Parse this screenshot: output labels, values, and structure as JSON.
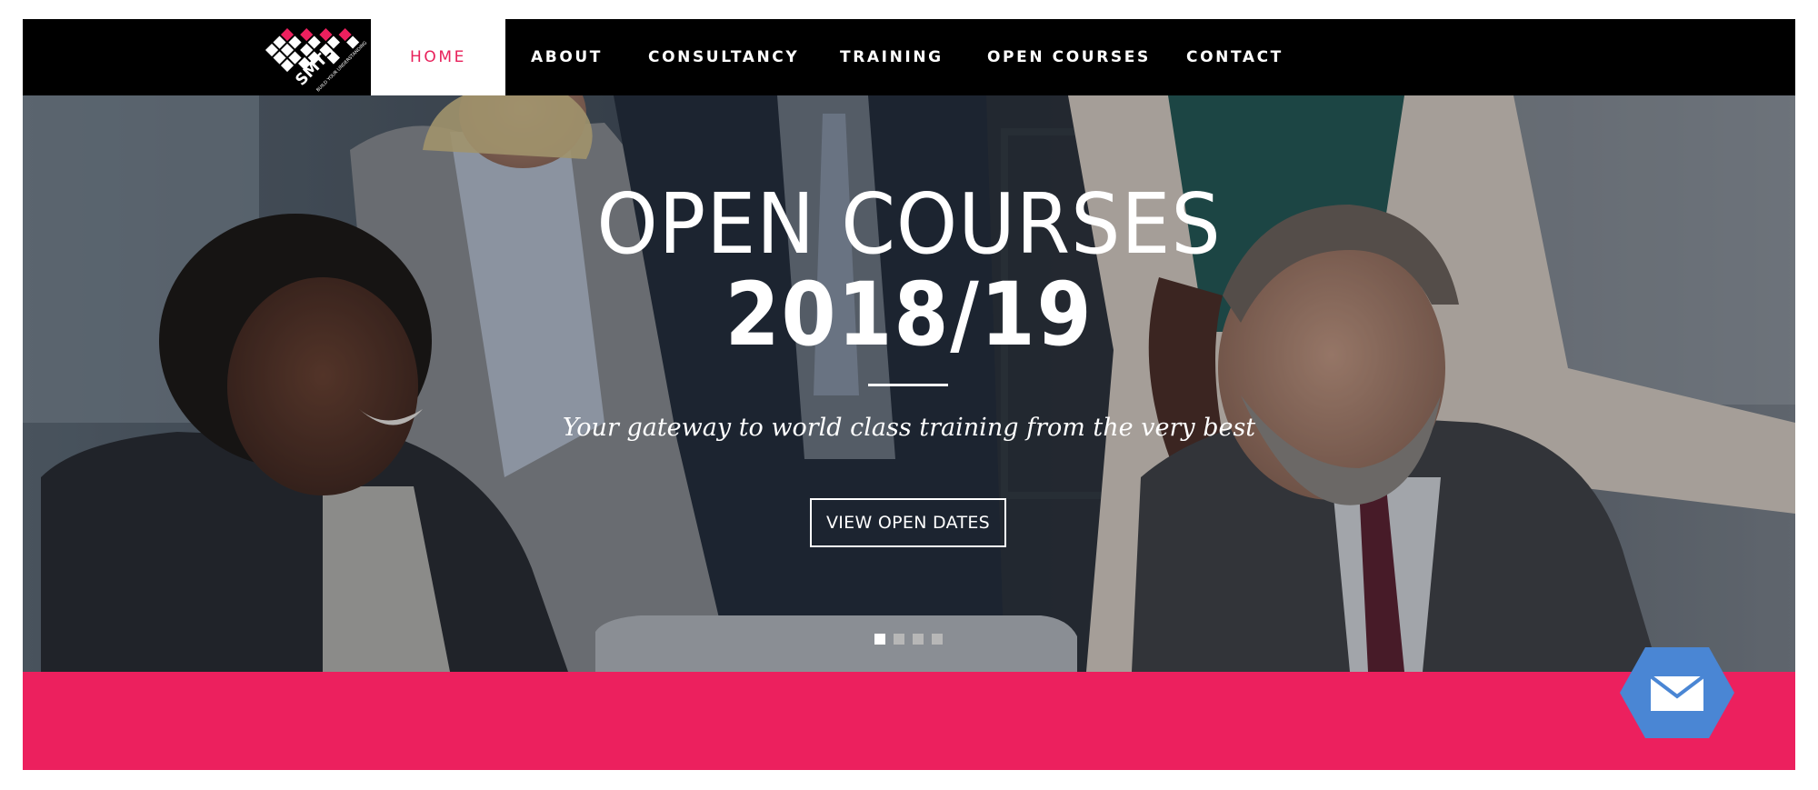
{
  "brand": {
    "logo_text": "SMTS",
    "logo_tagline": "BUILD YOUR UNDERSTANDING",
    "colors": {
      "accent": "#ec205e",
      "nav_bg": "#000000",
      "mail_button": "#4a86d4"
    }
  },
  "nav": {
    "items": [
      {
        "label": "HOME",
        "active": true
      },
      {
        "label": "ABOUT",
        "active": false
      },
      {
        "label": "CONSULTANCY",
        "active": false
      },
      {
        "label": "TRAINING",
        "active": false
      },
      {
        "label": "OPEN COURSES",
        "active": false
      },
      {
        "label": "CONTACT",
        "active": false
      }
    ]
  },
  "hero": {
    "title": "OPEN COURSES",
    "year": "2018/19",
    "tagline": "Your gateway to world class training from the very best",
    "button_label": "VIEW OPEN DATES",
    "slides_total": 4,
    "active_slide": 1
  },
  "floating": {
    "icon": "envelope-icon"
  }
}
